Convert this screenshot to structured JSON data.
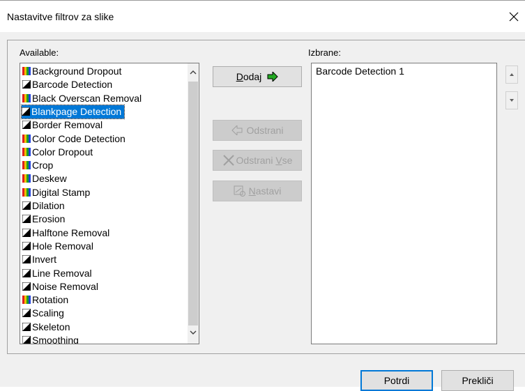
{
  "window": {
    "title": "Nastavitve filtrov za slike"
  },
  "available": {
    "label": "Available:",
    "items": [
      {
        "label": "Background Dropout",
        "icon": "color-bars-icon"
      },
      {
        "label": "Barcode Detection",
        "icon": "bw-icon"
      },
      {
        "label": "Black Overscan Removal",
        "icon": "color-bars-icon"
      },
      {
        "label": "Blankpage Detection",
        "icon": "bw-icon",
        "selected": true
      },
      {
        "label": "Border Removal",
        "icon": "bw-icon"
      },
      {
        "label": "Color Code Detection",
        "icon": "color-bars-icon"
      },
      {
        "label": "Color Dropout",
        "icon": "color-bars-icon"
      },
      {
        "label": "Crop",
        "icon": "color-bars-icon"
      },
      {
        "label": "Deskew",
        "icon": "color-bars-icon"
      },
      {
        "label": "Digital Stamp",
        "icon": "color-bars-icon"
      },
      {
        "label": "Dilation",
        "icon": "bw-icon"
      },
      {
        "label": "Erosion",
        "icon": "bw-icon"
      },
      {
        "label": "Halftone Removal",
        "icon": "bw-icon"
      },
      {
        "label": "Hole Removal",
        "icon": "bw-icon"
      },
      {
        "label": "Invert",
        "icon": "bw-icon"
      },
      {
        "label": "Line Removal",
        "icon": "bw-icon"
      },
      {
        "label": "Noise Removal",
        "icon": "bw-icon"
      },
      {
        "label": "Rotation",
        "icon": "color-bars-icon"
      },
      {
        "label": "Scaling",
        "icon": "bw-icon"
      },
      {
        "label": "Skeleton",
        "icon": "bw-icon"
      },
      {
        "label": "Smoothing",
        "icon": "bw-icon"
      }
    ]
  },
  "buttons": {
    "add": {
      "label": "Dodaj",
      "accel": "D"
    },
    "remove": {
      "label": "Odstrani"
    },
    "remove_all": {
      "label_pre": "Odstrani ",
      "label_accel": "V",
      "label_post": "se"
    },
    "configure": {
      "label_accel": "N",
      "label_post": "astavi"
    }
  },
  "selected": {
    "label": "Izbrane:",
    "items": [
      "Barcode Detection 1"
    ]
  },
  "footer": {
    "ok": "Potrdi",
    "cancel": "Prekliči"
  }
}
